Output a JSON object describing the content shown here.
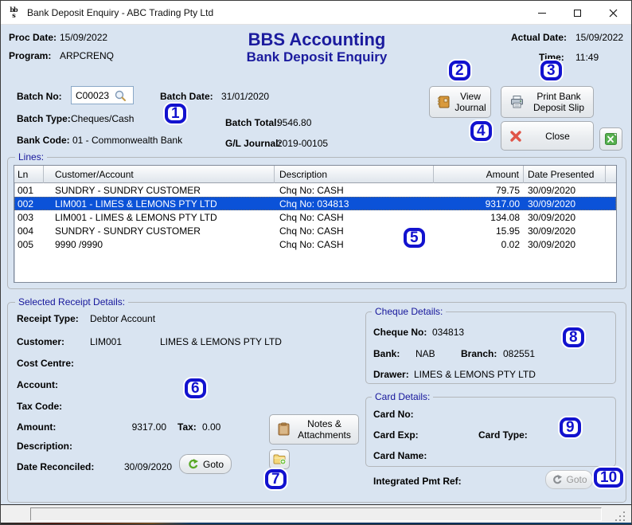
{
  "window": {
    "title": "Bank Deposit Enquiry - ABC Trading Pty Ltd",
    "app_logo_line1": "bb",
    "app_logo_line2": "s"
  },
  "header": {
    "proc_date_label": "Proc Date:",
    "proc_date": "15/09/2022",
    "program_label": "Program:",
    "program": "ARPCRENQ",
    "app_title": "BBS Accounting",
    "screen_title": "Bank Deposit Enquiry",
    "actual_date_label": "Actual Date:",
    "actual_date": "15/09/2022",
    "time_label": "Time:",
    "time": "11:49"
  },
  "batch": {
    "batch_no_label": "Batch No:",
    "batch_no": "C00023",
    "batch_date_label": "Batch Date:",
    "batch_date": "31/01/2020",
    "batch_type_label": "Batch Type:",
    "batch_type": "Cheques/Cash",
    "batch_total_label": "Batch Total:",
    "batch_total": "9546.80",
    "bank_code_label": "Bank Code:",
    "bank_code": "01 - Commonwealth Bank",
    "gl_journal_label": "G/L Journal:",
    "gl_journal": "2019-00105"
  },
  "toolbar": {
    "view_journal_label": "View Journal",
    "print_deposit_slip_label": "Print Bank Deposit Slip",
    "close_label": "Close"
  },
  "lines": {
    "group_label": "Lines:",
    "columns": [
      "Ln",
      "Customer/Account",
      "Description",
      "Amount",
      "Date Presented"
    ],
    "rows": [
      {
        "ln": "001",
        "customer": "SUNDRY - SUNDRY CUSTOMER",
        "description": "Chq No: CASH",
        "amount": "79.75",
        "date": "30/09/2020"
      },
      {
        "ln": "002",
        "customer": "LIM001 - LIMES & LEMONS PTY LTD",
        "description": "Chq No: 034813",
        "amount": "9317.00",
        "date": "30/09/2020"
      },
      {
        "ln": "003",
        "customer": "LIM001 - LIMES & LEMONS PTY LTD",
        "description": "Chq No: CASH",
        "amount": "134.08",
        "date": "30/09/2020"
      },
      {
        "ln": "004",
        "customer": "SUNDRY - SUNDRY CUSTOMER",
        "description": "Chq No: CASH",
        "amount": "15.95",
        "date": "30/09/2020"
      },
      {
        "ln": "005",
        "customer": "9990  /9990",
        "description": "Chq No: CASH",
        "amount": "0.02",
        "date": "30/09/2020"
      }
    ],
    "selected_row_index": 1
  },
  "receipt": {
    "group_label": "Selected Receipt Details:",
    "receipt_type_label": "Receipt Type:",
    "receipt_type": "Debtor Account",
    "customer_label": "Customer:",
    "customer_code": "LIM001",
    "customer_name": "LIMES & LEMONS PTY LTD",
    "cost_centre_label": "Cost Centre:",
    "account_label": "Account:",
    "tax_code_label": "Tax Code:",
    "amount_label": "Amount:",
    "amount": "9317.00",
    "tax_label": "Tax:",
    "tax": "0.00",
    "description_label": "Description:",
    "date_reconciled_label": "Date Reconciled:",
    "date_reconciled": "30/09/2020",
    "goto_label": "Goto",
    "notes_attachments_label": "Notes & Attachments"
  },
  "cheque": {
    "group_label": "Cheque Details:",
    "cheque_no_label": "Cheque No:",
    "cheque_no": "034813",
    "bank_label": "Bank:",
    "bank": "NAB",
    "branch_label": "Branch:",
    "branch": "082551",
    "drawer_label": "Drawer:",
    "drawer": "LIMES & LEMONS PTY LTD"
  },
  "card": {
    "group_label": "Card Details:",
    "card_no_label": "Card No:",
    "card_exp_label": "Card Exp:",
    "card_type_label": "Card Type:",
    "card_name_label": "Card Name:"
  },
  "integrated": {
    "label": "Integrated Pmt Ref:",
    "goto_label": "Goto"
  },
  "callouts": [
    "1",
    "2",
    "3",
    "4",
    "5",
    "6",
    "7",
    "8",
    "9",
    "10"
  ],
  "colors": {
    "background": "#d9e4f1",
    "title_navy": "#1b1b9e",
    "group_label_navy": "#16169b",
    "callout_blue": "#1212cf",
    "selection_blue": "#0b52d8",
    "close_red": "#d9534a",
    "excel_green": "#4caf50",
    "goto_green": "#58a826"
  }
}
